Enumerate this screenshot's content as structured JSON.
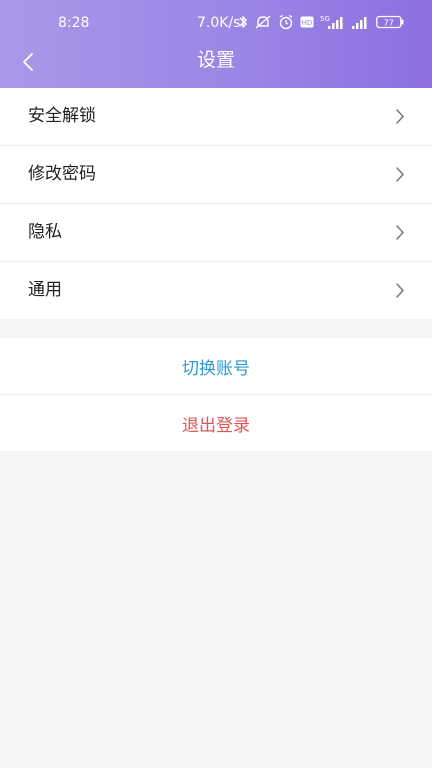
{
  "status_bar": {
    "time": "8:28",
    "network_speed": "7.0K/s",
    "signal_label": "5G",
    "hd_label": "HD",
    "battery": "77",
    "icons": [
      "bluetooth-icon",
      "mute-icon",
      "alarm-icon",
      "hd-icon",
      "signal-5g-icon",
      "signal-icon",
      "battery-icon"
    ]
  },
  "nav": {
    "title": "设置",
    "back_icon": "chevron-left-icon"
  },
  "menu": {
    "items": [
      {
        "label": "安全解锁",
        "icon": "chevron-right-icon"
      },
      {
        "label": "修改密码",
        "icon": "chevron-right-icon"
      },
      {
        "label": "隐私",
        "icon": "chevron-right-icon"
      },
      {
        "label": "通用",
        "icon": "chevron-right-icon"
      }
    ]
  },
  "actions": {
    "switch_account": "切换账号",
    "logout": "退出登录"
  },
  "colors": {
    "header_start": "#a998e8",
    "header_end": "#8d6fe0",
    "switch_account": "#2b9ad6",
    "logout": "#e05656",
    "background": "#f6f6f6"
  }
}
